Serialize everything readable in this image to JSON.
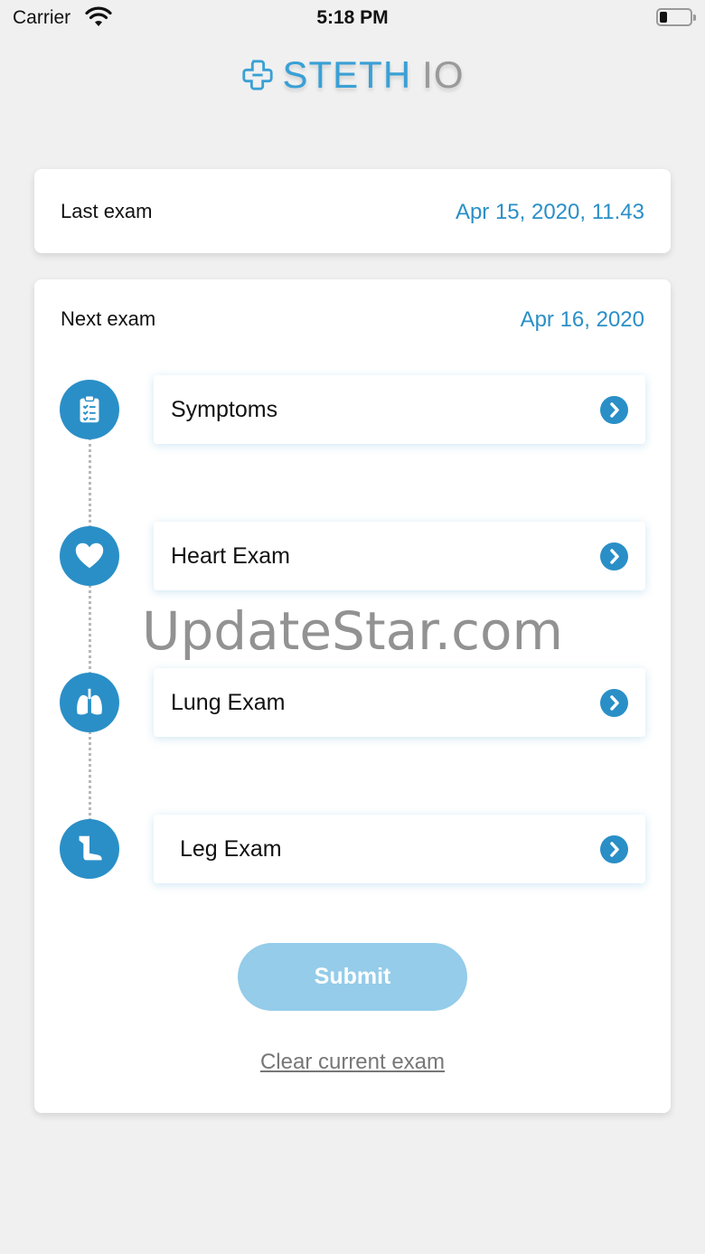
{
  "status_bar": {
    "carrier": "Carrier",
    "time": "5:18 PM"
  },
  "logo": {
    "part1": "STETH",
    "part2": "IO"
  },
  "last_exam": {
    "label": "Last exam",
    "value": "Apr 15, 2020, 11.43"
  },
  "next_exam": {
    "label": "Next exam",
    "value": "Apr 16, 2020",
    "steps": [
      {
        "label": "Symptoms",
        "icon": "clipboard-icon"
      },
      {
        "label": "Heart Exam",
        "icon": "heart-icon"
      },
      {
        "label": "Lung Exam",
        "icon": "lungs-icon"
      },
      {
        "label": "Leg Exam",
        "icon": "leg-icon"
      }
    ],
    "submit_label": "Submit",
    "clear_label": "Clear current exam"
  },
  "watermark": "UpdateStar.com",
  "colors": {
    "accent": "#2a8fc7",
    "submit_disabled": "#94cce9",
    "logo_blue": "#3aa0d5"
  }
}
